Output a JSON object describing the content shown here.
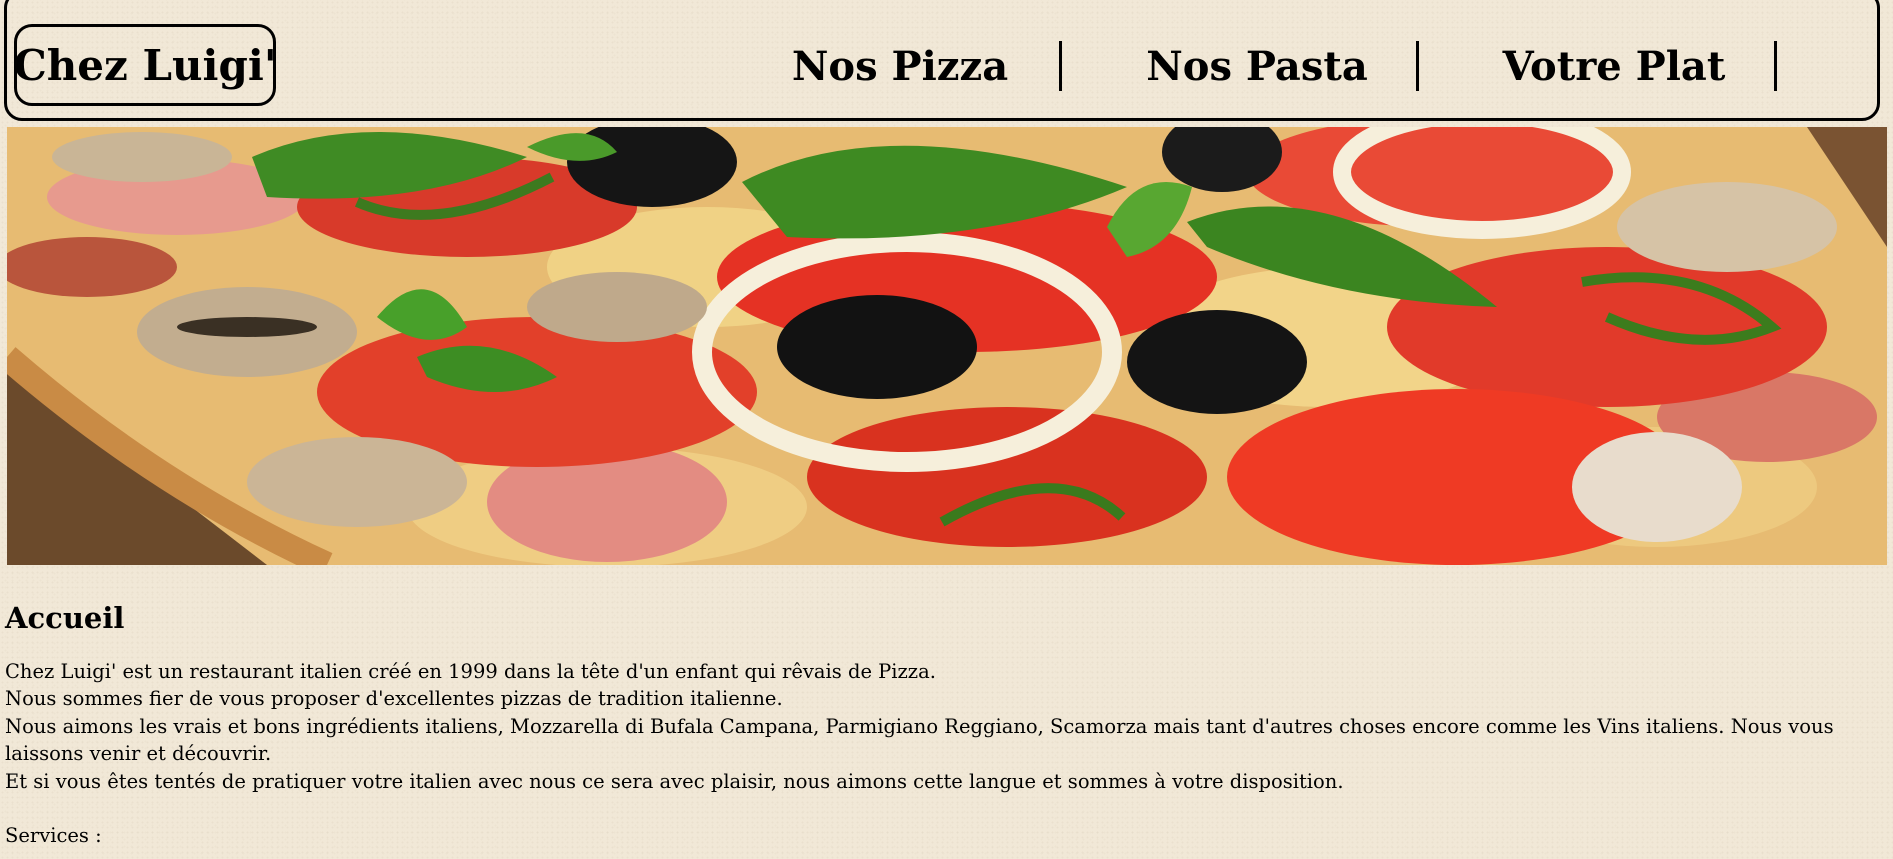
{
  "header": {
    "logo": "Chez Luigi'",
    "nav": [
      {
        "label": "Nos Pizza"
      },
      {
        "label": "Nos Pasta"
      },
      {
        "label": "Votre Plat"
      }
    ]
  },
  "hero": {
    "icon": "pizza-image"
  },
  "main": {
    "title": "Accueil",
    "paragraphs": [
      "Chez Luigi' est un restaurant italien créé en 1999 dans la tête d'un enfant qui rêvais de Pizza.",
      "Nous sommes fier de vous proposer d'excellentes pizzas de tradition italienne.",
      "Nous aimons les vrais et bons ingrédients italiens, Mozzarella di Bufala Campana, Parmigiano Reggiano, Scamorza mais tant d'autres choses encore comme les Vins italiens. Nous vous laissons venir et découvrir.",
      "Et si vous êtes tentés de pratiquer votre italien avec nous ce sera avec plaisir, nous aimons cette langue et sommes à votre disposition."
    ],
    "services_label": "Services :"
  },
  "colors": {
    "background": "#f1e8d7",
    "text": "#000000",
    "border": "#000000"
  }
}
